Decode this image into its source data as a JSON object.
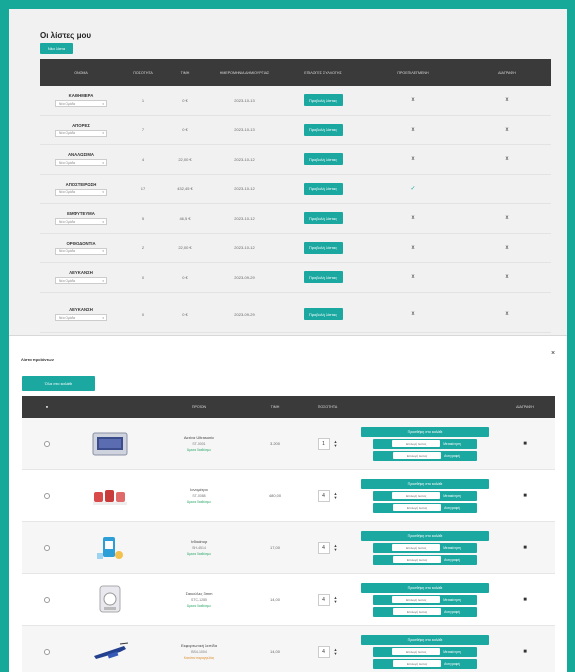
{
  "lists_title": "Οι λίστες μου",
  "new_list_label": "Νέα λίστα",
  "list_columns": [
    "ΟΝΟΜΑ",
    "ΠΟΣΟΤΗΤΑ",
    "ΤΙΜΗ",
    "ΗΜΕΡΟΜΗΝΙΑ ΔΗΜΙΟΥΡΓΙΑΣ",
    "ΕΠΙΛΟΓΕΣ ΣΥΛΛΟΓΗΣ",
    "ΠΡΟΕΠΙΛΕΓΜΕΝΗ",
    "ΔΙΑΓΡΑΦΗ"
  ],
  "lists": [
    {
      "name": "ΚΑΘΗΜΕΡΑ",
      "select": "Νέα Ομάδα",
      "qty": "1",
      "price": "0 €",
      "date": "2023-10-13",
      "button": "Προβολή λίστας",
      "default": "x",
      "delete": "x"
    },
    {
      "name": "ΑΠΟΡΕΣ",
      "select": "Νέα Ομάδα",
      "qty": "7",
      "price": "0 €",
      "date": "2023-10-13",
      "button": "Προβολή λίστας",
      "default": "x",
      "delete": "x"
    },
    {
      "name": "ΑΝΑΛΩΣΙΜΑ",
      "select": "Νέα Ομάδα",
      "qty": "4",
      "price": "22,00 €",
      "date": "2023-10-12",
      "button": "Προβολή λίστας",
      "default": "x",
      "delete": "x"
    },
    {
      "name": "ΑΠΟΣΤΕΙΡΩΣΗ",
      "select": "Νέα Ομάδα",
      "qty": "17",
      "price": "432,45 €",
      "date": "2023-10-12",
      "button": "Προβολή λίστας",
      "default": "✓",
      "delete": ""
    },
    {
      "name": "ΕΜΦΥΤΕΥΜΑ",
      "select": "Νέα Ομάδα",
      "qty": "5",
      "price": "46,5 €",
      "date": "2023-10-12",
      "button": "Προβολή λίστας",
      "default": "x",
      "delete": "x"
    },
    {
      "name": "ΟΡΘΟΔΟΝΤΙΑ",
      "select": "Νέα Ομάδα",
      "qty": "2",
      "price": "22,00 €",
      "date": "2023-10-12",
      "button": "Προβολή λίστας",
      "default": "x",
      "delete": "x"
    },
    {
      "name": "ΛΕΥΚΑΝΣΗ",
      "select": "Νέα Ομάδα",
      "qty": "0",
      "price": "0 €",
      "date": "2023-09-29",
      "button": "Προβολή λίστας",
      "default": "x",
      "delete": "x"
    },
    {
      "name": "ΛΕΥΚΑΝΣΗ",
      "select": "Νέα Ομάδα",
      "qty": "0",
      "price": "0 €",
      "date": "2023-09-29",
      "button": "Προβολή λίστας",
      "default": "x",
      "delete": "x"
    }
  ],
  "products_title": "Λίστα προϊόντων",
  "products_close": "×",
  "add_all_label": "Όλα στο καλάθι",
  "product_columns": [
    "",
    "",
    "ΠΡΟΪΟΝ",
    "ΤΙΜΗ",
    "ΠΟΣΟΤΗΤΑ",
    "",
    "ΔΙΑΓΡΑΦΗ"
  ],
  "header_mark": "■",
  "qty_up": "▲",
  "qty_down": "▼",
  "products": [
    {
      "name": "Ακτίνα Ultrasonic",
      "code": "ST-0001",
      "stock": "Άμεσα διαθέσιμο",
      "stock_color": "#2aa86a",
      "price": "3.200",
      "qty": "1",
      "image": "tray",
      "actions": {
        "add": "Προσθήκη στο καλάθι",
        "move_sel": "Επιλογή λίστας",
        "move": "Μετακίνηση",
        "copy_sel": "Επιλογή λίστας",
        "copy": "Αντιγραφή"
      }
    },
    {
      "name": "Ιονομέτρο",
      "code": "ST-0088",
      "stock": "Άμεσα διαθέσιμο",
      "stock_color": "#2aa86a",
      "price": "480,00",
      "qty": "4",
      "image": "cups",
      "actions": {
        "add": "Προσθήκη στο καλάθι",
        "move_sel": "Επιλογή λίστας",
        "move": "Μετακίνηση",
        "copy_sel": "Επιλογή λίστας",
        "copy": "Αντιγραφή"
      }
    },
    {
      "name": "Ινδικάτορ",
      "code": "SH-4514",
      "stock": "Άμεσα διαθέσιμο",
      "stock_color": "#2aa86a",
      "price": "17,00",
      "qty": "4",
      "image": "bottle",
      "actions": {
        "add": "Προσθήκη στο καλάθι",
        "move_sel": "Επιλογή λίστας",
        "move": "Μετακίνηση",
        "copy_sel": "Επιλογή λίστας",
        "copy": "Αντιγραφή"
      }
    },
    {
      "name": "Σακούλες 3mm",
      "code": "STC-1285",
      "stock": "Άμεσα διαθέσιμο",
      "stock_color": "#2aa86a",
      "price": "14,00",
      "qty": "4",
      "image": "machine",
      "actions": {
        "add": "Προσθήκη στο καλάθι",
        "move_sel": "Επιλογή λίστας",
        "move": "Μετακίνηση",
        "copy_sel": "Επιλογή λίστας",
        "copy": "Αντιγραφή"
      }
    },
    {
      "name": "Εκφορτωτική λεπίδα",
      "code": "BS4-1004",
      "stock": "Κατόπιν παραγγελίας",
      "stock_color": "#e08a2a",
      "price": "14,00",
      "qty": "4",
      "image": "tool",
      "actions": {
        "add": "Προσθήκη στο καλάθι",
        "move_sel": "Επιλογή λίστας",
        "move": "Μετακίνηση",
        "copy_sel": "Επιλογή λίστας",
        "copy": "Αντιγραφή"
      }
    }
  ],
  "accent": "#1aa8a1",
  "header_bg": "#3a3a3a"
}
